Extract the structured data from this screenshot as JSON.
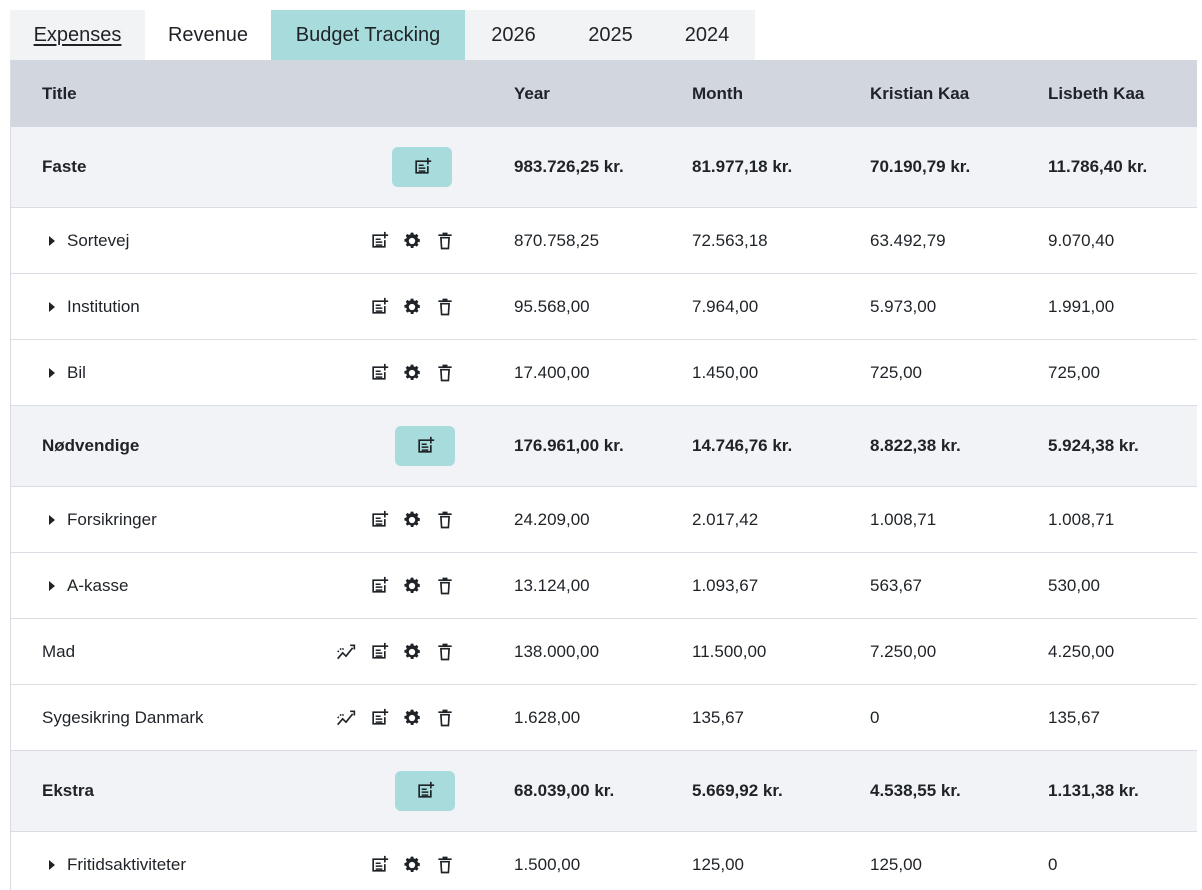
{
  "tabs": [
    {
      "label": "Expenses",
      "style": "underlined"
    },
    {
      "label": "Revenue",
      "style": "white"
    },
    {
      "label": "Budget Tracking",
      "style": "active"
    },
    {
      "label": "2026",
      "style": "plain"
    },
    {
      "label": "2025",
      "style": "plain"
    },
    {
      "label": "2024",
      "style": "plain"
    }
  ],
  "columns": {
    "title": "Title",
    "year": "Year",
    "month": "Month",
    "kristian": "Kristian Kaa",
    "lisbeth": "Lisbeth Kaa"
  },
  "rows": [
    {
      "type": "group",
      "title": "Faste",
      "year": "983.726,25 kr.",
      "month": "81.977,18 kr.",
      "kristian": "70.190,79 kr.",
      "lisbeth": "11.786,40 kr."
    },
    {
      "type": "item",
      "expandable": true,
      "title": "Sortevej",
      "year": "870.758,25",
      "month": "72.563,18",
      "kristian": "63.492,79",
      "lisbeth": "9.070,40"
    },
    {
      "type": "item",
      "expandable": true,
      "title": "Institution",
      "year": "95.568,00",
      "month": "7.964,00",
      "kristian": "5.973,00",
      "lisbeth": "1.991,00"
    },
    {
      "type": "item",
      "expandable": true,
      "title": "Bil",
      "year": "17.400,00",
      "month": "1.450,00",
      "kristian": "725,00",
      "lisbeth": "725,00"
    },
    {
      "type": "group",
      "title": "Nødvendige",
      "year": "176.961,00 kr.",
      "month": "14.746,76 kr.",
      "kristian": "8.822,38 kr.",
      "lisbeth": "5.924,38 kr."
    },
    {
      "type": "item",
      "expandable": true,
      "title": "Forsikringer",
      "year": "24.209,00",
      "month": "2.017,42",
      "kristian": "1.008,71",
      "lisbeth": "1.008,71"
    },
    {
      "type": "item",
      "expandable": true,
      "title": "A-kasse",
      "year": "13.124,00",
      "month": "1.093,67",
      "kristian": "563,67",
      "lisbeth": "530,00"
    },
    {
      "type": "item",
      "expandable": false,
      "trend": true,
      "title": "Mad",
      "year": "138.000,00",
      "month": "11.500,00",
      "kristian": "7.250,00",
      "lisbeth": "4.250,00"
    },
    {
      "type": "item",
      "expandable": false,
      "trend": true,
      "title": "Sygesikring Danmark",
      "year": "1.628,00",
      "month": "135,67",
      "kristian": "0",
      "lisbeth": "135,67"
    },
    {
      "type": "group",
      "title": "Ekstra",
      "year": "68.039,00 kr.",
      "month": "5.669,92 kr.",
      "kristian": "4.538,55 kr.",
      "lisbeth": "1.131,38 kr."
    },
    {
      "type": "item",
      "expandable": true,
      "title": "Fritidsaktiviteter",
      "year": "1.500,00",
      "month": "125,00",
      "kristian": "125,00",
      "lisbeth": "0"
    }
  ],
  "icons": {
    "add": "note-add-icon",
    "settings": "gear-icon",
    "delete": "trash-icon",
    "trend": "trend-icon",
    "expand": "caret-right-icon"
  },
  "colors": {
    "accent": "#a8dbdb",
    "header_bg": "#d2d6de",
    "group_bg": "#f1f3f6",
    "tab_bar_bg": "#f1f3f5"
  }
}
